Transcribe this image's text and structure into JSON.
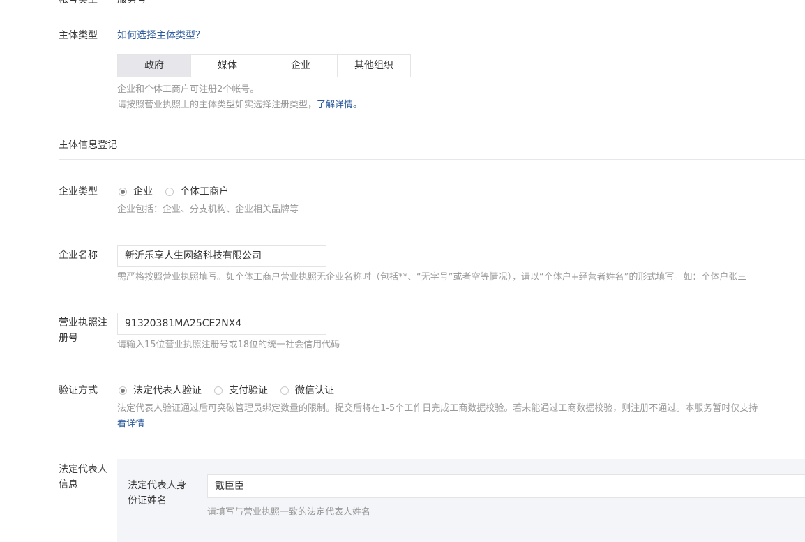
{
  "account_type": {
    "label": "帐号类型",
    "value": "服务号"
  },
  "subject_type": {
    "label": "主体类型",
    "help_link": "如何选择主体类型？",
    "options": [
      "政府",
      "媒体",
      "企业",
      "其他组织"
    ],
    "tip_line1": "企业和个体工商户可注册2个帐号。",
    "tip_line2_prefix": "请按照营业执照上的主体类型如实选择注册类型，",
    "tip_line2_link": "了解详情。"
  },
  "section_title": "主体信息登记",
  "enterprise_type": {
    "label": "企业类型",
    "options": [
      "企业",
      "个体工商户"
    ],
    "tip": "企业包括：企业、分支机构、企业相关品牌等"
  },
  "enterprise_name": {
    "label": "企业名称",
    "value": "新沂乐享人生网络科技有限公司",
    "tip": "需严格按照营业执照填写。如个体工商户营业执照无企业名称时（包括**、“无字号”或者空等情况），请以“个体户+经营者姓名”的形式填写。如：个体户张三"
  },
  "license_number": {
    "label_line1": "营业执照注",
    "label_line2": "册号",
    "value": "91320381MA25CE2NX4",
    "tip": "请输入15位营业执照注册号或18位的统一社会信用代码"
  },
  "verification": {
    "label": "验证方式",
    "options": [
      "法定代表人验证",
      "支付验证",
      "微信认证"
    ],
    "tip": "法定代表人验证通过后可突破管理员绑定数量的限制。提交后将在1-5个工作日完成工商数据校验。若未能通过工商数据校验，则注册不通过。本服务暂时仅支持",
    "detail_link": "看详情"
  },
  "legal_rep": {
    "label_line1": "法定代表人",
    "label_line2": "信息",
    "name_label_line1": "法定代表人身",
    "name_label_line2": "份证姓名",
    "name_value": "戴臣臣",
    "name_tip": "请填写与营业执照一致的法定代表人姓名"
  }
}
